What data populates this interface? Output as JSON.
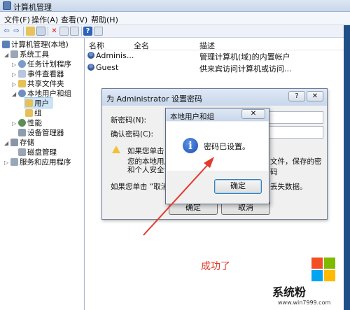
{
  "window": {
    "title": "计算机管理"
  },
  "menu": [
    "文件(F)",
    "操作(A)",
    "查看(V)",
    "帮助(H)"
  ],
  "tree": {
    "root": "计算机管理(本地)",
    "system_tools": "系统工具",
    "task_scheduler": "任务计划程序",
    "event_viewer": "事件查看器",
    "shared_folders": "共享文件夹",
    "local_users_groups": "本地用户和组",
    "users": "用户",
    "groups": "组",
    "performance": "性能",
    "device_manager": "设备管理器",
    "storage": "存储",
    "disk_management": "磁盘管理",
    "services_apps": "服务和应用程序"
  },
  "list": {
    "columns": [
      "名称",
      "全名",
      "描述"
    ],
    "rows": [
      {
        "name": "Adminis...",
        "fullname": "",
        "desc": "管理计算机(域)的内置帐户"
      },
      {
        "name": "Guest",
        "fullname": "",
        "desc": "供来宾访问计算机或访问..."
      }
    ]
  },
  "password_dialog": {
    "title": "为 Administrator 设置密码",
    "help": "?",
    "close": "✕",
    "new_password_label": "新密码(N):",
    "confirm_password_label": "确认密码(C):",
    "warning_line1": "如果您单击 “",
    "warning_line1_end": "文件，保存的密码",
    "warning_line2": "您的本地用户",
    "warning_line2_end": "",
    "warning_line3": "和个人安全证",
    "cancel_note_start": "如果您单击 “取消",
    "cancel_note_end": "丢失数据。",
    "ok_button": "确定",
    "cancel_button": "取消"
  },
  "message_box": {
    "title": "本地用户和组",
    "close": "✕",
    "message": "密码已设置。",
    "ok_button": "确定",
    "icon": "i"
  },
  "annotation": {
    "text": "成功了"
  },
  "watermark": {
    "text": "系统粉",
    "url": "www.win7999.com"
  },
  "colors": {
    "arrow": "#e23b2c",
    "accent": "#2b5aa0"
  }
}
